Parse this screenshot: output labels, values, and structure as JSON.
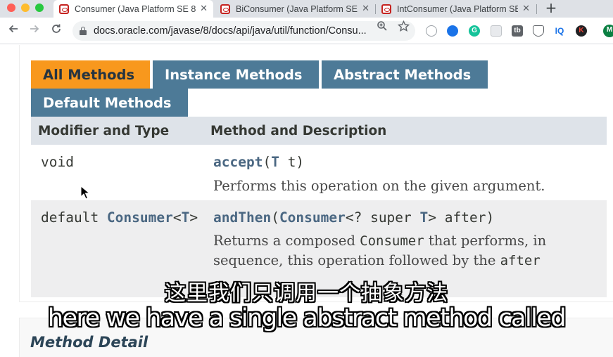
{
  "browser": {
    "tabs": [
      {
        "title": "Consumer (Java Platform SE 8",
        "active": true
      },
      {
        "title": "BiConsumer (Java Platform SE",
        "active": false
      },
      {
        "title": "IntConsumer (Java Platform SE",
        "active": false
      }
    ],
    "close_glyph": "✕",
    "new_tab_glyph": "+",
    "url": "docs.oracle.com/javase/8/docs/api/java/util/function/Consu...",
    "extensions": [
      {
        "name": "grammarly",
        "label": "G",
        "color": "#15c39a"
      },
      {
        "name": "tb",
        "label": "tb",
        "color": "#5f6368"
      },
      {
        "name": "iq",
        "label": "IQ",
        "color": "#1a73e8"
      },
      {
        "name": "k",
        "label": "K",
        "color": "#d93025"
      },
      {
        "name": "profile",
        "label": "M",
        "color": "#0b8043"
      }
    ]
  },
  "method_tabs": {
    "all": "All Methods",
    "instance": "Instance Methods",
    "abstract": "Abstract Methods",
    "default": "Default Methods"
  },
  "summary_table": {
    "headers": {
      "modifier": "Modifier and Type",
      "method": "Method and Description"
    },
    "rows": [
      {
        "type": "void",
        "method_name": "accept",
        "signature": [
          "(",
          "T",
          " t)"
        ],
        "description": "Performs this operation on the given argument."
      },
      {
        "type_prefix": "default ",
        "type_link": "Consumer",
        "type_open": "<",
        "type_param": "T",
        "type_close": ">",
        "method_name": "andThen",
        "sig_open": "(",
        "sig_type": "Consumer",
        "sig_mid": "<? super ",
        "sig_param": "T",
        "sig_end": "> after)",
        "desc_line1_a": "Returns a composed ",
        "desc_line1_code": "Consumer",
        "desc_line1_b": " that performs, in",
        "desc_line2_a": "sequence, this operation followed by the ",
        "desc_line2_code": "after"
      }
    ]
  },
  "section_title": "Method Detail",
  "subtitles": {
    "zh": "这里我们只调用一个抽象方法",
    "en": "here we have a single abstract method called"
  },
  "colors": {
    "tab_active": "#f8981d",
    "tab_inactive": "#4d7a97",
    "header_bg": "#dee3e9",
    "link": "#4a6782"
  }
}
